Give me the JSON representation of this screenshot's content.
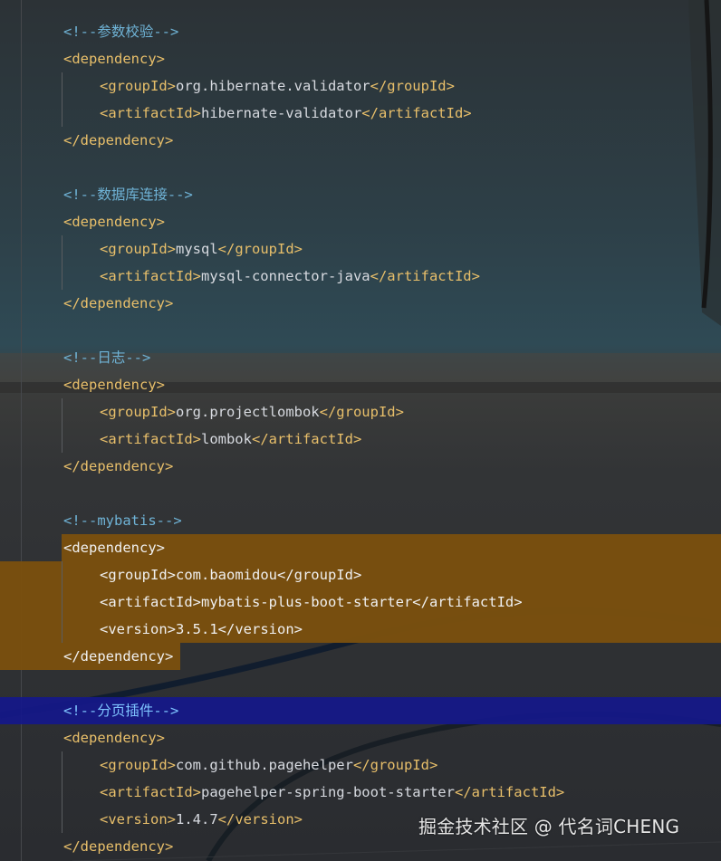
{
  "editor": {
    "lines": [
      {
        "kind": "comment",
        "text": "<!--参数校验-->"
      },
      {
        "kind": "open",
        "tag": "dependency"
      },
      {
        "kind": "element",
        "tag": "groupId",
        "value": "org.hibernate.validator"
      },
      {
        "kind": "element",
        "tag": "artifactId",
        "value": "hibernate-validator"
      },
      {
        "kind": "close",
        "tag": "dependency"
      },
      {
        "kind": "blank"
      },
      {
        "kind": "comment",
        "text": "<!--数据库连接-->"
      },
      {
        "kind": "open",
        "tag": "dependency"
      },
      {
        "kind": "element",
        "tag": "groupId",
        "value": "mysql"
      },
      {
        "kind": "element",
        "tag": "artifactId",
        "value": "mysql-connector-java"
      },
      {
        "kind": "close",
        "tag": "dependency"
      },
      {
        "kind": "blank"
      },
      {
        "kind": "comment",
        "text": "<!--日志-->"
      },
      {
        "kind": "open",
        "tag": "dependency"
      },
      {
        "kind": "element",
        "tag": "groupId",
        "value": "org.projectlombok"
      },
      {
        "kind": "element",
        "tag": "artifactId",
        "value": "lombok"
      },
      {
        "kind": "close",
        "tag": "dependency"
      },
      {
        "kind": "blank"
      },
      {
        "kind": "comment",
        "text": "<!--mybatis-->"
      },
      {
        "kind": "open",
        "tag": "dependency",
        "highlight": "selection"
      },
      {
        "kind": "element",
        "tag": "groupId",
        "value": "com.baomidou",
        "highlight": "selection"
      },
      {
        "kind": "element",
        "tag": "artifactId",
        "value": "mybatis-plus-boot-starter",
        "highlight": "selection"
      },
      {
        "kind": "element",
        "tag": "version",
        "value": "3.5.1",
        "highlight": "selection"
      },
      {
        "kind": "close",
        "tag": "dependency",
        "highlight": "selection"
      },
      {
        "kind": "blank"
      },
      {
        "kind": "comment",
        "text": "<!--分页插件-->",
        "highlight": "caret"
      },
      {
        "kind": "open",
        "tag": "dependency"
      },
      {
        "kind": "element",
        "tag": "groupId",
        "value": "com.github.pagehelper"
      },
      {
        "kind": "element",
        "tag": "artifactId",
        "value": "pagehelper-spring-boot-starter"
      },
      {
        "kind": "element",
        "tag": "version",
        "value": "1.4.7"
      },
      {
        "kind": "close",
        "tag": "dependency"
      }
    ]
  },
  "watermark": "掘金技术社区 @ 代名词CHENG",
  "colors": {
    "tag": "#e8bf6a",
    "value": "#d7dae0",
    "comment": "#6fb3d6",
    "selection": "#7a4f0e",
    "caret_line": "#15188a"
  }
}
